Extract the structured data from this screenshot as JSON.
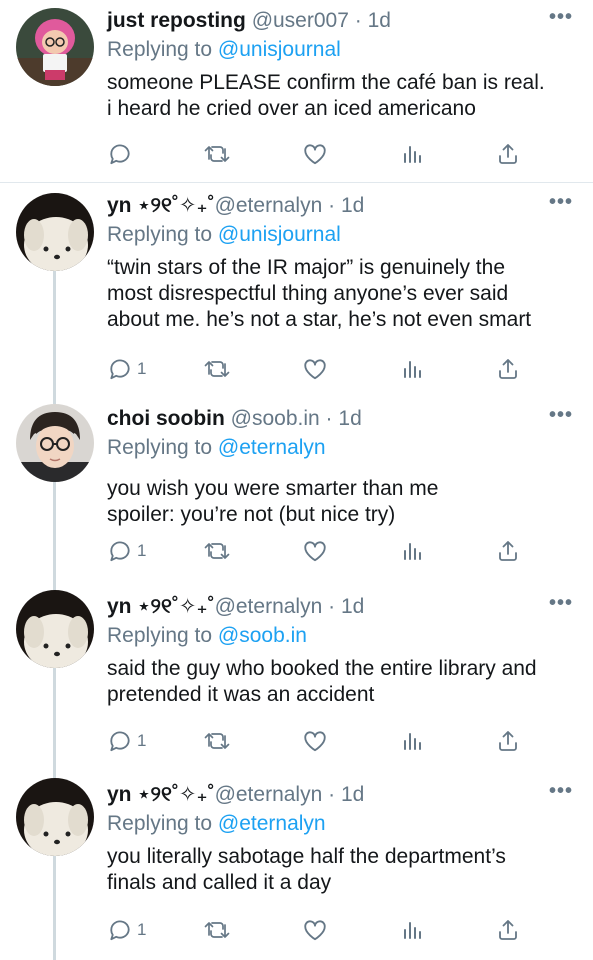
{
  "tweets": [
    {
      "name": "just reposting",
      "handle": "@user007",
      "sep": " · ",
      "time": "1d",
      "replying_prefix": "Replying to ",
      "replying_to": "@unisjournal",
      "body": "someone PLEASE confirm the café ban is real.\ni heard he cried over an iced americano",
      "reply_count": "",
      "more": "•••",
      "avatar": "pink-haired-figurine-avatar"
    },
    {
      "name": "yn",
      "name_deco": " ⋆୨୧˚✧₊˚",
      "handle": "@eternalyn",
      "sep": " · ",
      "time": "1d",
      "replying_prefix": "Replying to ",
      "replying_to": "@unisjournal",
      "body": "“twin stars of the IR major” is genuinely the\nmost disrespectful thing anyone’s ever said\nabout me. he’s not a star, he’s not even smart",
      "reply_count": "1",
      "more": "•••",
      "avatar": "white-plush-dog-avatar"
    },
    {
      "name": "choi soobin",
      "handle": "@soob.in",
      "sep": " · ",
      "time": "1d",
      "replying_prefix": "Replying to ",
      "replying_to": "@eternalyn",
      "body": "you wish you were smarter than me\nspoiler: you’re not (but nice try)",
      "reply_count": "1",
      "more": "•••",
      "avatar": "person-with-glasses-avatar"
    },
    {
      "name": "yn",
      "name_deco": " ⋆୨୧˚✧₊˚",
      "handle": "@eternalyn",
      "sep": " · ",
      "time": "1d",
      "replying_prefix": "Replying to ",
      "replying_to": "@soob.in",
      "body": "said the guy who booked the entire library and\npretended it was an accident",
      "reply_count": "1",
      "more": "•••",
      "avatar": "white-plush-dog-avatar"
    },
    {
      "name": "yn",
      "name_deco": " ⋆୨୧˚✧₊˚",
      "handle": "@eternalyn",
      "sep": " · ",
      "time": "1d",
      "replying_prefix": "Replying to ",
      "replying_to": "@eternalyn",
      "body": "you literally sabotage half the department’s\nfinals and called it a day",
      "reply_count": "1",
      "more": "•••",
      "avatar": "white-plush-dog-avatar"
    }
  ],
  "colors": {
    "text": "#14171a",
    "muted": "#657786",
    "link": "#1da1f2",
    "divider": "#e1e8ed",
    "thread": "#cfd9de"
  }
}
